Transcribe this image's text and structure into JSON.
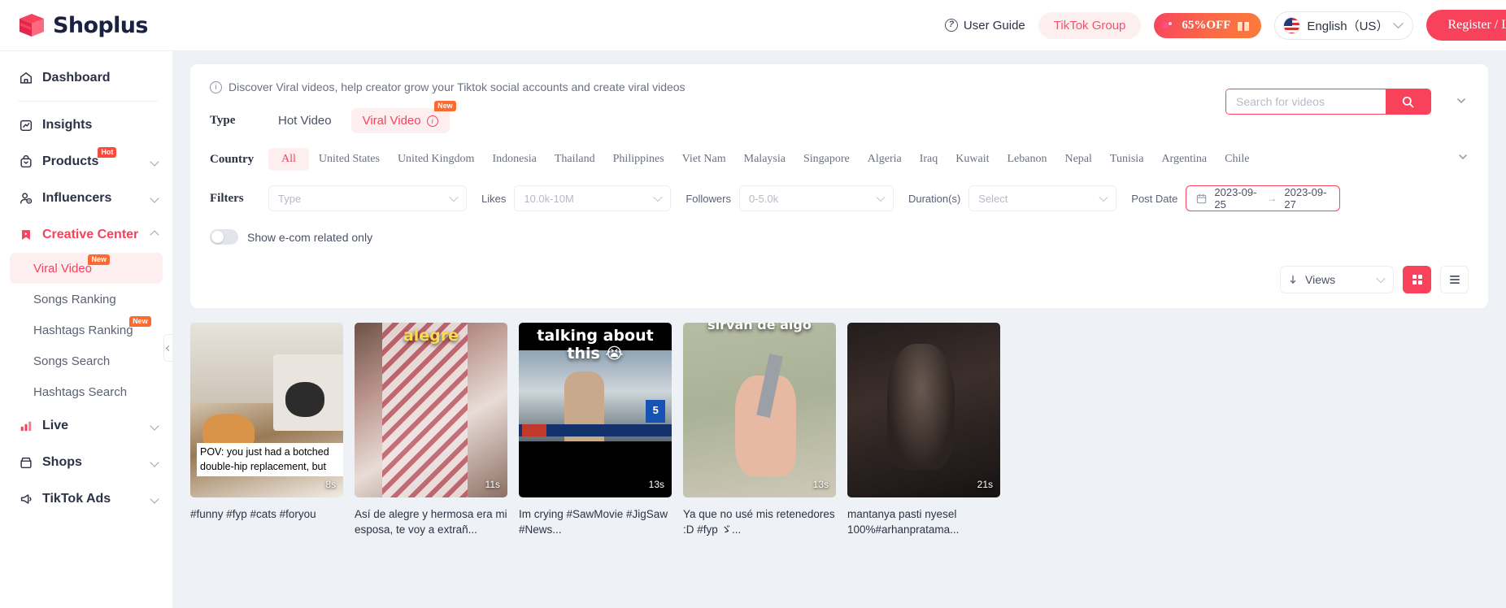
{
  "header": {
    "logo_text": "Shoplus",
    "user_guide": "User Guide",
    "tiktok_group": "TikTok Group",
    "promo": "65%OFF",
    "language": "English（US）",
    "register": "Register / L",
    "accent": "#f8415b"
  },
  "sidebar": {
    "items": [
      {
        "label": "Dashboard",
        "icon": "home-icon",
        "badge": "",
        "caret": "none"
      },
      {
        "label": "Insights",
        "icon": "chart-icon",
        "badge": "",
        "caret": "none"
      },
      {
        "label": "Products",
        "icon": "bag-icon",
        "badge": "Hot",
        "caret": "down"
      },
      {
        "label": "Influencers",
        "icon": "user-icon",
        "badge": "",
        "caret": "down"
      },
      {
        "label": "Creative Center",
        "icon": "bookmark-play-icon",
        "badge": "",
        "caret": "up"
      }
    ],
    "sub_items": [
      {
        "label": "Viral Video",
        "badge": "New",
        "active": true
      },
      {
        "label": "Songs Ranking",
        "badge": "",
        "active": false
      },
      {
        "label": "Hashtags Ranking",
        "badge": "New",
        "active": false
      },
      {
        "label": "Songs Search",
        "badge": "",
        "active": false
      },
      {
        "label": "Hashtags Search",
        "badge": "",
        "active": false
      }
    ],
    "bottom_items": [
      {
        "label": "Live",
        "icon": "bars-icon",
        "caret": "down"
      },
      {
        "label": "Shops",
        "icon": "shop-icon",
        "caret": "down"
      },
      {
        "label": "TikTok Ads",
        "icon": "megaphone-icon",
        "caret": "down"
      }
    ]
  },
  "main": {
    "tip": "Discover Viral videos, help creator grow your Tiktok social accounts and create viral videos",
    "search_placeholder": "Search for videos",
    "type_label": "Type",
    "type_tabs": [
      {
        "label": "Hot Video",
        "active": false,
        "badge": ""
      },
      {
        "label": "Viral Video",
        "active": true,
        "badge": "New"
      }
    ],
    "country_label": "Country",
    "countries": [
      "All",
      "United States",
      "United Kingdom",
      "Indonesia",
      "Thailand",
      "Philippines",
      "Viet Nam",
      "Malaysia",
      "Singapore",
      "Algeria",
      "Iraq",
      "Kuwait",
      "Lebanon",
      "Nepal",
      "Tunisia",
      "Argentina",
      "Chile"
    ],
    "country_active": "All",
    "filters_label": "Filters",
    "filters": {
      "type_value": "Type",
      "likes_label": "Likes",
      "likes_value": "10.0k-10M",
      "followers_label": "Followers",
      "followers_value": "0-5.0k",
      "duration_label": "Duration(s)",
      "duration_value": "Select",
      "post_date_label": "Post Date",
      "date_from": "2023-09-25",
      "date_to": "2023-09-27",
      "date_arrow": "→"
    },
    "ecom_toggle_label": "Show e-com related only",
    "ecom_toggle_on": false,
    "sort_value": "Views",
    "sort_icon": "sort-desc-icon"
  },
  "cards": [
    {
      "caption": "#funny #fyp #cats #foryou",
      "duration": "8s",
      "overlay_caption": "POV: you just had a botched double-hip replacement, but",
      "overlay_top": ""
    },
    {
      "caption": "Así de alegre y hermosa era mi esposa, te voy a extrañ...",
      "duration": "11s",
      "overlay_caption": "",
      "overlay_top": "alegre"
    },
    {
      "caption": "Im crying #SawMovie #JigSaw #News...",
      "duration": "13s",
      "overlay_caption": "",
      "overlay_top": "talking about this 😭"
    },
    {
      "caption": "Ya que no usé mis retenedores :D #fyp ゞ...",
      "duration": "13s",
      "overlay_caption": "",
      "overlay_top": "separadas que no sirvan de algo"
    },
    {
      "caption": "mantanya pasti nyesel 100%#arhanpratama...",
      "duration": "21s",
      "overlay_caption": "",
      "overlay_top": ""
    }
  ]
}
